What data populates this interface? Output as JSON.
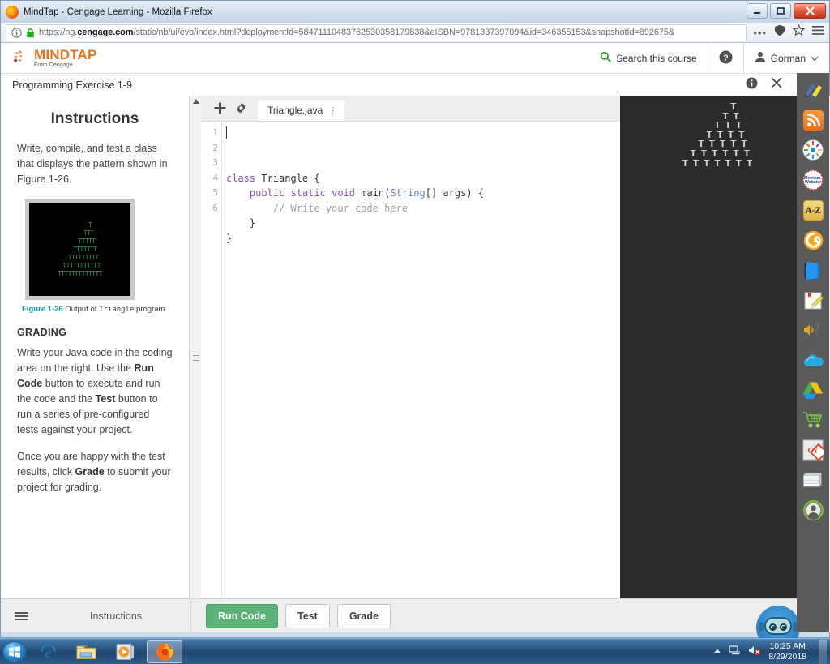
{
  "window": {
    "title": "MindTap - Cengage Learning - Mozilla Firefox",
    "minimize_label": "–",
    "maximize_label": "□",
    "close_label": "✕"
  },
  "browser": {
    "url_prefix": "https://ng.",
    "url_domain": "cengage.com",
    "url_rest": "/static/nb/ui/evo/index.html?deploymentId=58471110483762530358179838&eISBN=9781337397094&id=346355153&snapshotId=892675&",
    "menu_dots": "•••"
  },
  "mindtap_header": {
    "logo_word": "MINDTAP",
    "logo_sub": "From Cengage",
    "search_label": "Search this course",
    "help_label": "?",
    "user_name": "Gorman",
    "user_caret": "∨"
  },
  "exercise_bar": {
    "title": "Programming Exercise 1-9",
    "info_label": "i",
    "close_label": "✕"
  },
  "instructions": {
    "heading": "Instructions",
    "intro": "Write, compile, and test a class that displays the pattern shown in Figure 1-26.",
    "figure": {
      "pattern": "      T\n     TTT\n    TTTTT\n   TTTTTTT\n  TTTTTTTTT\n TTTTTTTTTTT\nTTTTTTTTTTTTT",
      "caption_number": "Figure 1-26",
      "caption_text_before": "Output of ",
      "caption_mono": "Triangle",
      "caption_text_after": " program"
    },
    "grading_heading": "GRADING",
    "grading_p1_a": "Write your Java code in the coding area on the right. Use the ",
    "grading_p1_b": "Run Code",
    "grading_p1_c": " button to execute and run the code and the ",
    "grading_p1_d": "Test",
    "grading_p1_e": " button to run a series of pre-configured tests against your project.",
    "grading_p2_a": "Once you are happy with the test results, click ",
    "grading_p2_b": "Grade",
    "grading_p2_c": " to submit your project for grading."
  },
  "editor": {
    "add_tab_label": "+",
    "settings_label": "⚙",
    "file_tab_name": "Triangle.java",
    "tab_menu_label": "⋮",
    "line_numbers": [
      "1",
      "2",
      "3",
      "4",
      "5",
      "6"
    ],
    "code_lines": [
      {
        "text": "class Triangle {",
        "tokens": [
          {
            "t": "class",
            "c": "plain"
          },
          {
            "t": " Triangle {",
            "c": "plain"
          }
        ]
      },
      {
        "text": "    public static void main(String[] args) {"
      },
      {
        "text": "        // Write your code here"
      },
      {
        "text": "    }"
      },
      {
        "text": "}"
      },
      {
        "text": ""
      }
    ]
  },
  "console": {
    "output": "      T\n     T T\n    T T T\n   T T T T\n  T T T T T\n T T T T T T\nT T T T T T T"
  },
  "bottom_bar": {
    "menu_label": "menu",
    "instructions_label": "Instructions",
    "run_code_label": "Run Code",
    "test_label": "Test",
    "grade_label": "Grade"
  },
  "tool_sidebar": {
    "items": [
      {
        "name": "highlighter-icon",
        "label": "Highlighter"
      },
      {
        "name": "rss-icon",
        "label": "RSS Feed"
      },
      {
        "name": "pinwheel-icon",
        "label": "Study Tools"
      },
      {
        "name": "merriam-webster-icon",
        "label": "Merriam-Webster"
      },
      {
        "name": "dictionary-az-icon",
        "label": "A-Z"
      },
      {
        "name": "orange-circle-icon",
        "label": "App"
      },
      {
        "name": "blue-book-icon",
        "label": "eBook"
      },
      {
        "name": "notepad-icon",
        "label": "Notes"
      },
      {
        "name": "text-to-speech-icon",
        "label": "Read Aloud"
      },
      {
        "name": "cloud-icon",
        "label": "Cloud"
      },
      {
        "name": "google-drive-icon",
        "label": "Google Drive"
      },
      {
        "name": "shopping-cart-icon",
        "label": "Cart"
      },
      {
        "name": "cy-badge-icon",
        "label": "CY"
      },
      {
        "name": "flashcards-icon",
        "label": "Flashcards"
      },
      {
        "name": "profile-avatar-icon",
        "label": "Profile"
      }
    ]
  },
  "taskbar": {
    "start_label": "Start",
    "items": [
      {
        "name": "taskbar-internet-explorer",
        "label": "Internet Explorer"
      },
      {
        "name": "taskbar-file-explorer",
        "label": "File Explorer"
      },
      {
        "name": "taskbar-media-player",
        "label": "Windows Media Player"
      },
      {
        "name": "taskbar-firefox",
        "label": "Mozilla Firefox"
      }
    ],
    "time": "10:25 AM",
    "date": "8/29/2018"
  },
  "colors": {
    "mindtap_orange": "#e8731f",
    "run_green": "#5cb377",
    "console_bg": "#2b2b2b",
    "figure_green": "#2f9e5f"
  }
}
